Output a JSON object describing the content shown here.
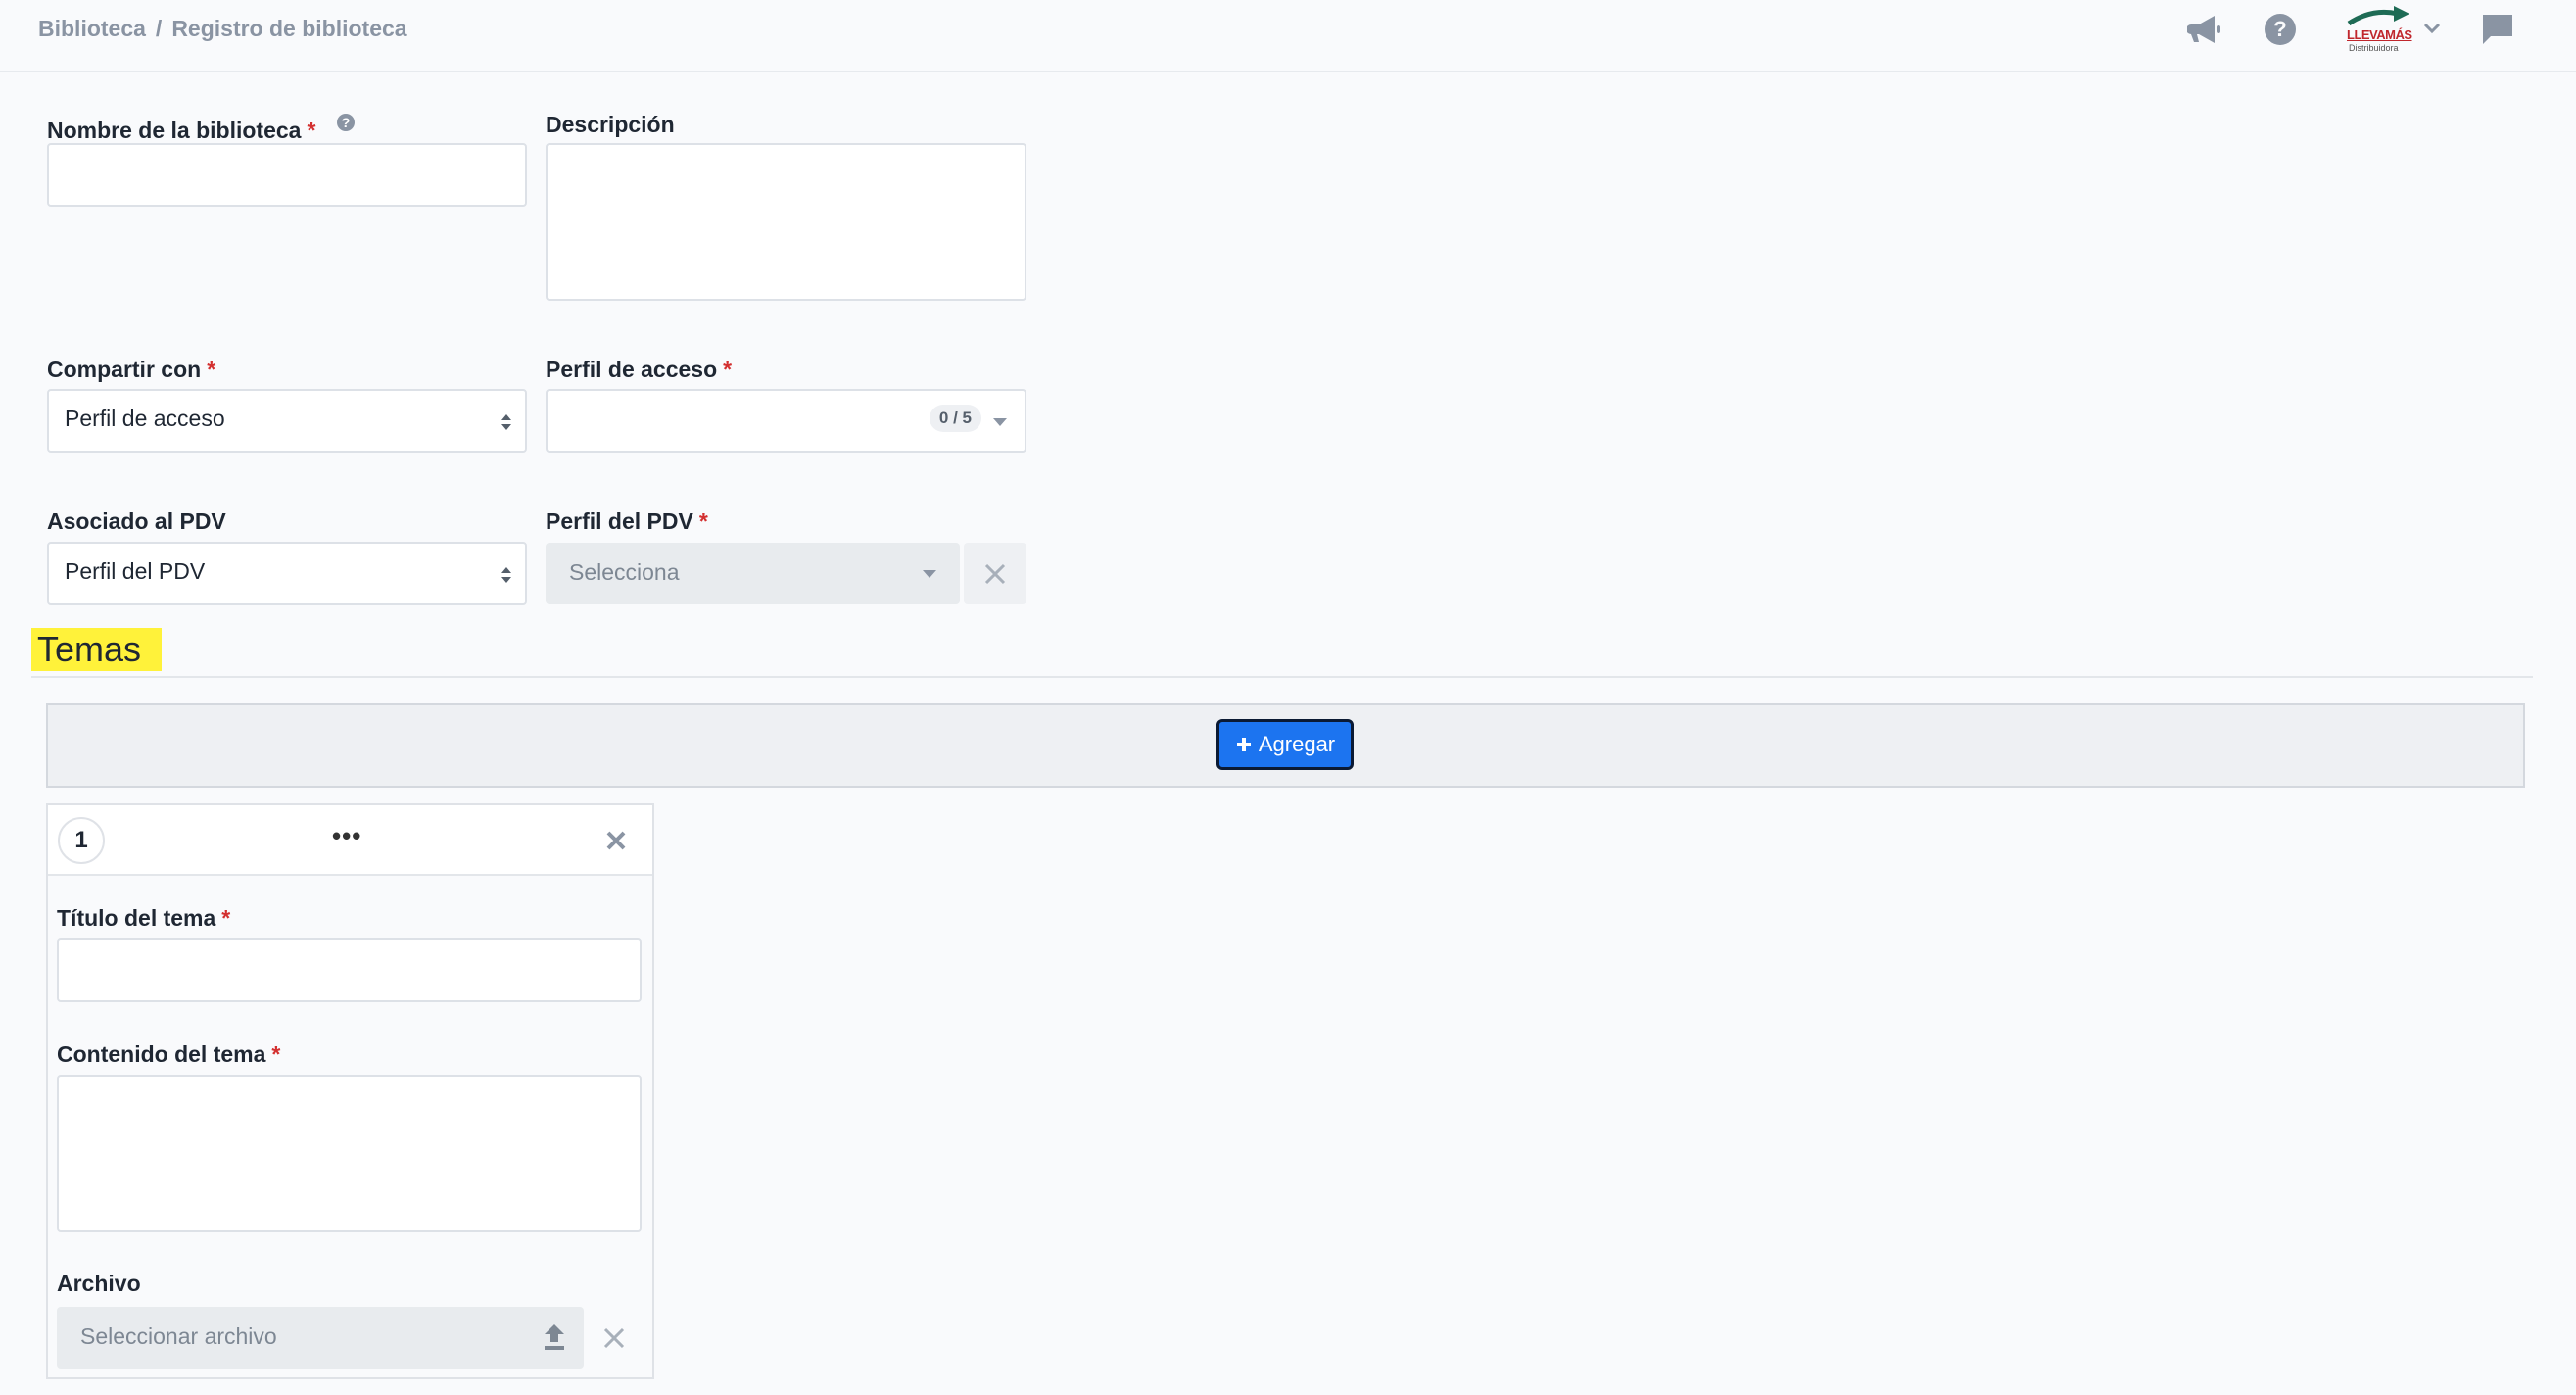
{
  "breadcrumb": {
    "root": "Biblioteca",
    "separator": "/",
    "current": "Registro de biblioteca"
  },
  "header": {
    "logo_text": "LLEVAMÁS",
    "logo_sub": "Distribuidora"
  },
  "form": {
    "nombre": {
      "label": "Nombre de la biblioteca",
      "required": "*",
      "value": ""
    },
    "descripcion": {
      "label": "Descripción",
      "value": ""
    },
    "compartir": {
      "label": "Compartir con",
      "required": "*",
      "value": "Perfil de acceso"
    },
    "perfil_acceso": {
      "label": "Perfil de acceso",
      "required": "*",
      "counter": "0 / 5"
    },
    "asociado": {
      "label": "Asociado al PDV",
      "value": "Perfil del PDV"
    },
    "perfil_pdv": {
      "label": "Perfil del PDV",
      "required": "*",
      "placeholder": "Selecciona"
    }
  },
  "temas": {
    "title": "Temas",
    "add_label": "Agregar",
    "items": [
      {
        "number": "1",
        "menu": "•••",
        "titulo_label": "Título del tema",
        "contenido_label": "Contenido del tema",
        "archivo_label": "Archivo",
        "archivo_placeholder": "Seleccionar archivo",
        "required": "*"
      }
    ]
  },
  "colors": {
    "accent": "#1c74f0",
    "required": "#d32f2f",
    "highlight": "#fff23a"
  }
}
